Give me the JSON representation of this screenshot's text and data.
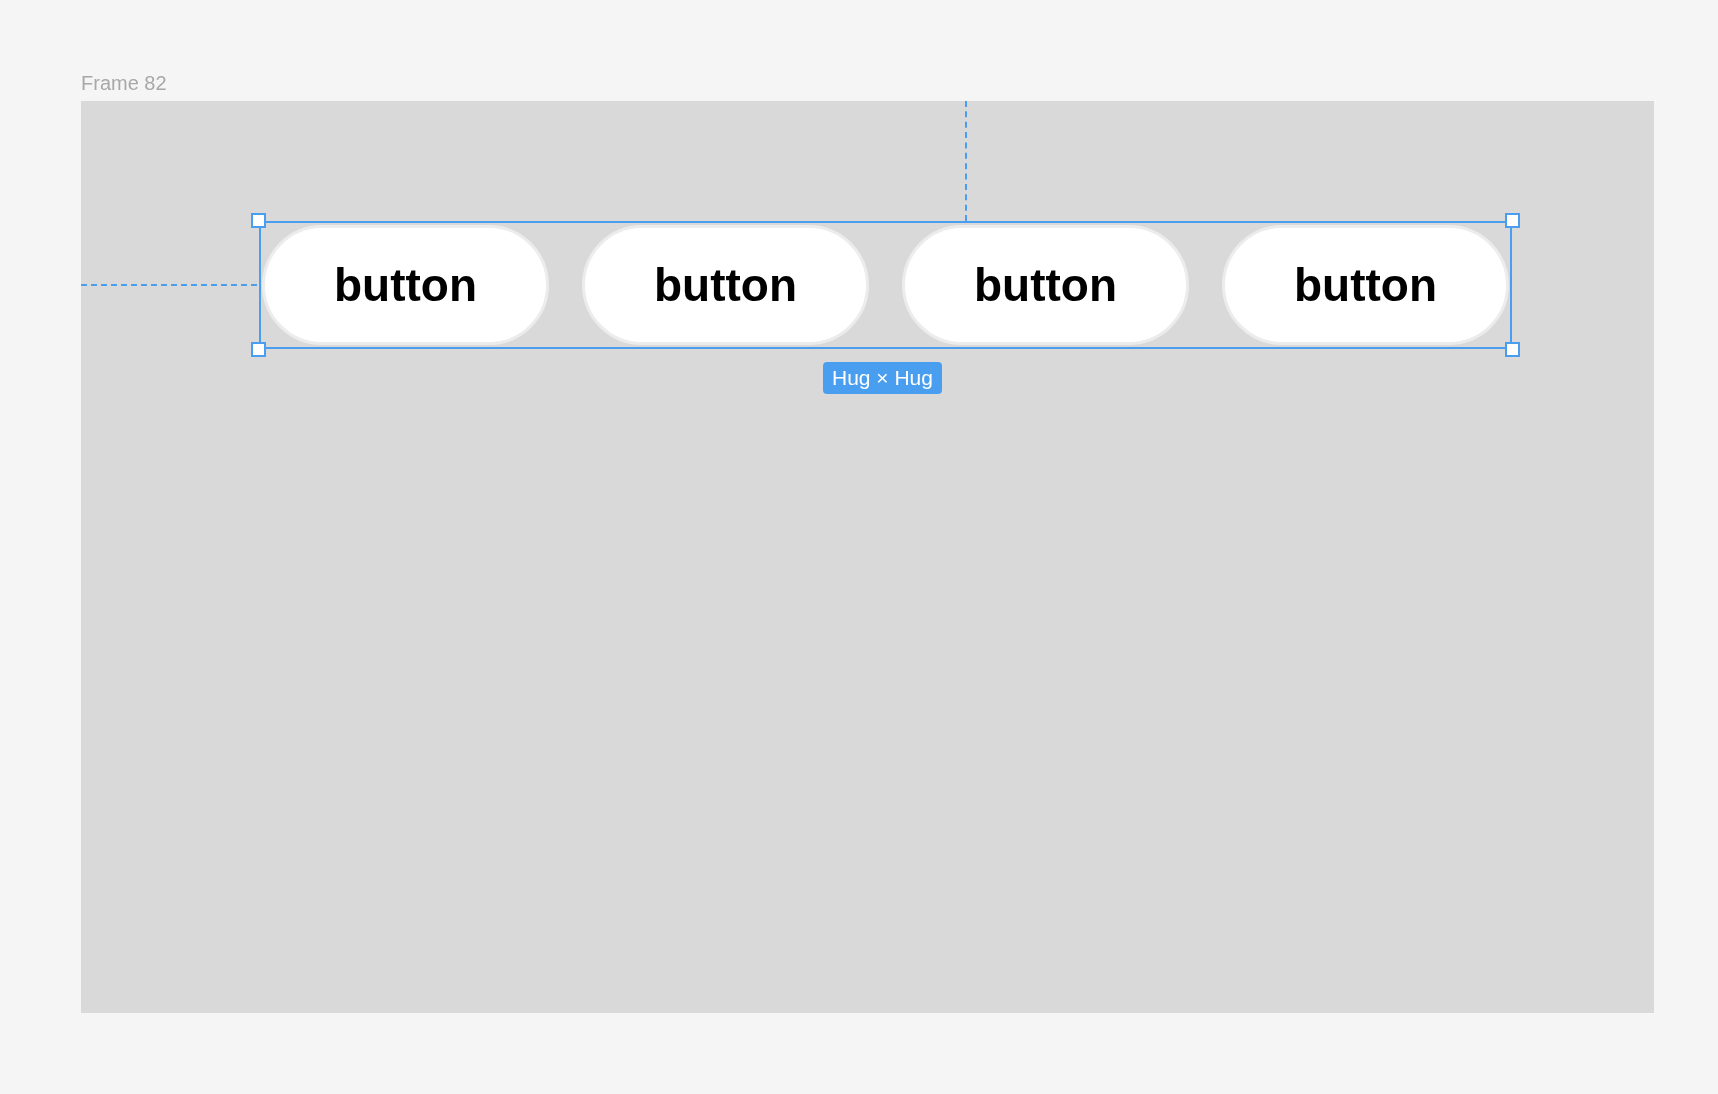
{
  "frame": {
    "title": "Frame 82"
  },
  "selection": {
    "size_label": "Hug × Hug",
    "buttons": [
      {
        "label": "button"
      },
      {
        "label": "button"
      },
      {
        "label": "button"
      },
      {
        "label": "button"
      }
    ]
  }
}
